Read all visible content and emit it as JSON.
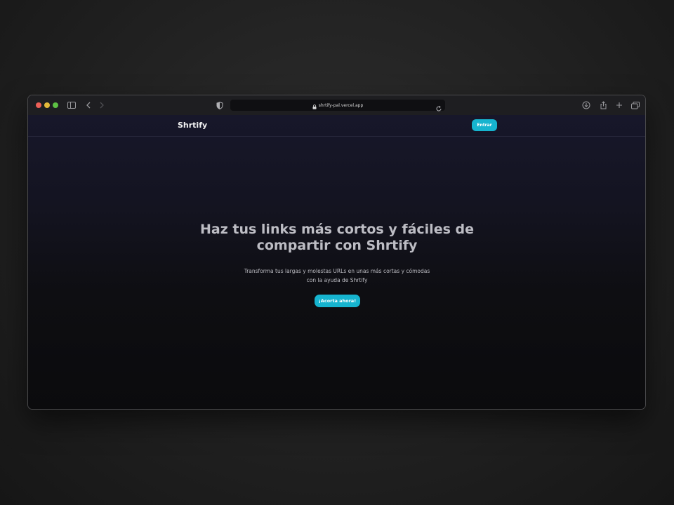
{
  "browser": {
    "url": "shrtify-pal.vercel.app",
    "icons": {
      "sidebar": "sidebar-icon",
      "back": "chevron-left-icon",
      "forward": "chevron-right-icon",
      "shield": "shield-icon",
      "lock": "lock-icon",
      "reload": "reload-icon",
      "download": "download-icon",
      "share": "share-icon",
      "new_tab": "plus-icon",
      "tabs": "tabs-overview-icon"
    }
  },
  "navbar": {
    "brand": "Shrtify",
    "login_label": "Entrar"
  },
  "hero": {
    "title": "Haz tus links más cortos y fáciles de compartir con Shrtify",
    "subtitle": "Transforma tus largas y molestas URLs en unas más cortas y cómodas con la ayuda de Shrtify",
    "cta_label": "¡Acorta ahora!"
  },
  "colors": {
    "accent": "#16b4cf",
    "background": "#0c0c0f",
    "title": "#bdbdc4"
  }
}
